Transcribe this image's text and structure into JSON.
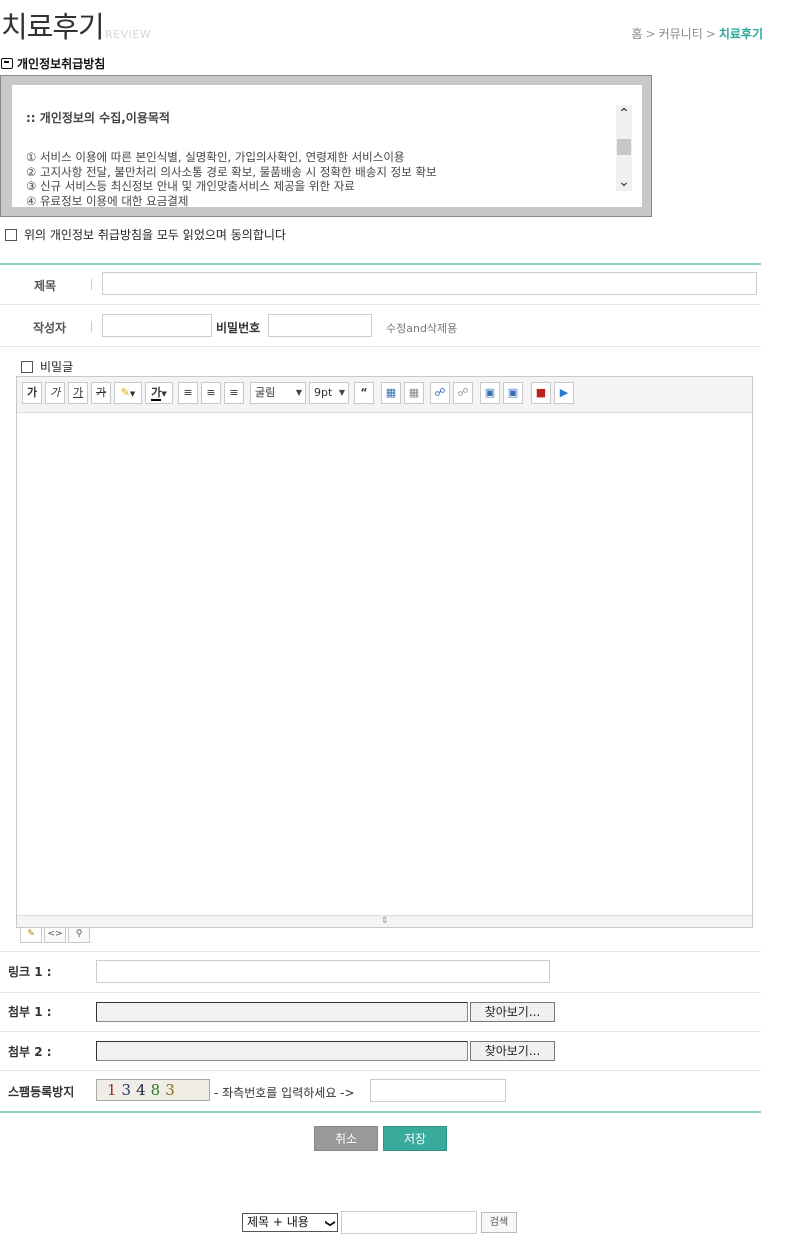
{
  "header": {
    "title": "치료후기",
    "subtitle": "REVIEW",
    "breadcrumb": [
      "홈",
      "커뮤니티",
      "치료후기"
    ],
    "breadcrumb_sep": ">"
  },
  "privacy": {
    "heading": "개인정보취급방침",
    "box_title": ":: 개인정보의 수집,이용목적",
    "items": [
      "① 서비스 이용에 따른 본인식별, 실명확인, 가입의사확인, 연령제한 서비스이용",
      "② 고지사항 전달, 불만처리 의사소통 경로 확보, 물품배송 시 정확한 배송지 정보 확보",
      "③ 신규 서비스등 최신정보 안내 및 개인맞춤서비스 제공을 위한 자료",
      "④ 유료정보 이용에 대한 요금결제"
    ],
    "agree_label": "위의 개인정보 취급방침을 모두 읽었으며 동의합니다"
  },
  "form": {
    "subject_label": "제목",
    "subject_value": "",
    "author_label": "작성자",
    "author_value": "",
    "password_label": "비밀번호",
    "password_value": "",
    "password_hint": "수정and삭제용",
    "secret_label": "비밀글"
  },
  "editor": {
    "font_value": "굴림",
    "size_value": "9pt",
    "quote_glyph": "“",
    "buttons": {
      "bold": "가",
      "italic": "가",
      "underline": "가",
      "strike": "가"
    }
  },
  "fields": {
    "link1_label": "링크 1 :",
    "link1_value": "",
    "file1_label": "첨부 1 :",
    "file2_label": "첨부 2 :",
    "browse_label": "찾아보기...",
    "spam_label": "스팸등록방지",
    "captcha_digits": [
      "1",
      "3",
      "4",
      "8",
      "3"
    ],
    "captcha_colors": [
      "#9b2a1e",
      "#1f3b7a",
      "#23233a",
      "#2f7a2a",
      "#8a6a1c"
    ],
    "captcha_hint": "- 좌측번호를 입력하세요 ->",
    "captcha_value": ""
  },
  "actions": {
    "cancel_label": "취소",
    "save_label": "저장"
  },
  "search": {
    "select_value": "제목 + 내용",
    "input_value": "",
    "button_label": "검색"
  },
  "colors": {
    "accent": "#2aa69a",
    "save": "#3aaa9a",
    "cancel": "#999999",
    "teal_line": "#8fd1c9"
  }
}
